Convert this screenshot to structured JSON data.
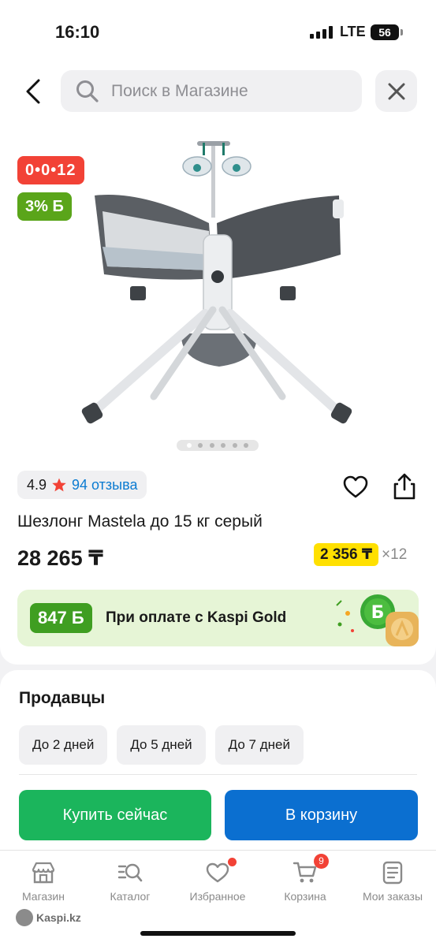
{
  "status_bar": {
    "time": "16:10",
    "network": "LTE",
    "battery": "56"
  },
  "header": {
    "search_placeholder": "Поиск в Магазине"
  },
  "product": {
    "timer_badge": "0•0•12",
    "bonus_badge": "3% Б",
    "rating": "4.9",
    "reviews": "94 отзыва",
    "title": "Шезлонг Mastela до 15 кг серый",
    "price": "28 265 ₸",
    "installment": {
      "amount": "2 356 ₸",
      "multiplier": "×12"
    },
    "gold_banner": {
      "amount": "847 Б",
      "text": "При оплате с Kaspi Gold"
    },
    "gallery": {
      "total": 6,
      "active": 1
    }
  },
  "sellers": {
    "title": "Продавцы",
    "delivery_filters": [
      "До 2 дней",
      "До 5 дней",
      "До 7 дней"
    ],
    "buy_now_label": "Купить сейчас",
    "add_to_cart_label": "В корзину"
  },
  "bottom_nav": {
    "items": [
      {
        "label": "Магазин",
        "icon": "store-icon"
      },
      {
        "label": "Каталог",
        "icon": "catalog-search-icon"
      },
      {
        "label": "Избранное",
        "icon": "heart-icon"
      },
      {
        "label": "Корзина",
        "icon": "cart-icon"
      },
      {
        "label": "Мои заказы",
        "icon": "orders-icon"
      }
    ],
    "cart_count": "9"
  },
  "watermark": "Kaspi.kz",
  "colors": {
    "timer_red": "#f24236",
    "bonus_green": "#5aa51a",
    "buy_green": "#1bb55c",
    "cart_blue": "#0b6fd0",
    "installment_yellow": "#ffe000",
    "link_blue": "#0b7bd1"
  }
}
